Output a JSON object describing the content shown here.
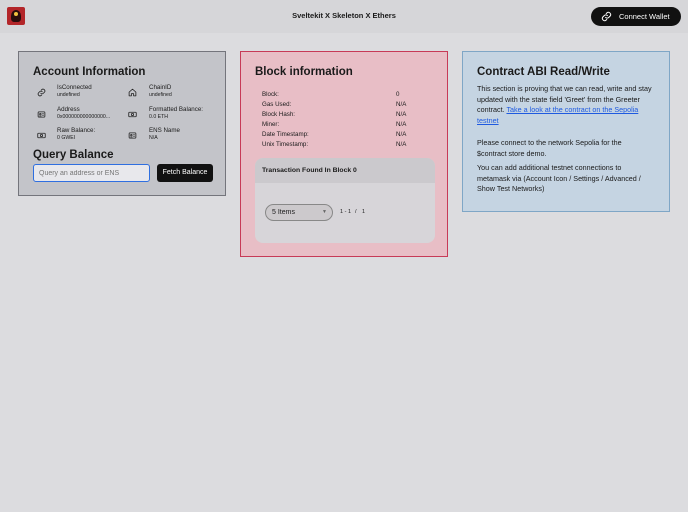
{
  "header": {
    "title": "Sveltekit X Skeleton X Ethers",
    "connect_label": "Connect Wallet"
  },
  "account": {
    "title": "Account Information",
    "is_connected": {
      "label": "IsConnected",
      "value": "undefined"
    },
    "chain_id": {
      "label": "ChainID",
      "value": "undefined"
    },
    "address": {
      "label": "Address",
      "value": "0x000000000000000..."
    },
    "formatted_balance": {
      "label": "Formatted Balance:",
      "value": "0.0 ETH"
    },
    "raw_balance": {
      "label": "Raw Balance:",
      "value": "0 GWEI"
    },
    "ens_name": {
      "label": "ENS Name",
      "value": "N/A"
    },
    "query_title": "Query Balance",
    "query_placeholder": "Query an address or ENS",
    "fetch_label": "Fetch Balance"
  },
  "block": {
    "title": "Block information",
    "rows": [
      {
        "label": "Block:",
        "value": "0"
      },
      {
        "label": "Gas Used:",
        "value": "N/A"
      },
      {
        "label": "Block Hash:",
        "value": "N/A"
      },
      {
        "label": "Miner:",
        "value": "N/A"
      },
      {
        "label": "Date Timestamp:",
        "value": "N/A"
      },
      {
        "label": "Unix Timestamp:",
        "value": "N/A"
      }
    ],
    "tx_title": "Transaction Found In Block 0",
    "page_size": "5 Items",
    "range": "1 - 1",
    "sep": "/",
    "total": "1"
  },
  "abi": {
    "title": "Contract ABI Read/Write",
    "p1": "This section is proving that we can read, write and stay updated with the state field 'Greet' from the Greeter contract.",
    "p1_link": "Take a look at the contract on the Sepolia testnet",
    "p2": "Please connect to the network Sepolia for the $contract store demo.",
    "p3": "You can add additional testnet connections to metamask via (Account Icon / Settings / Advanced / Show Test Networks)"
  }
}
